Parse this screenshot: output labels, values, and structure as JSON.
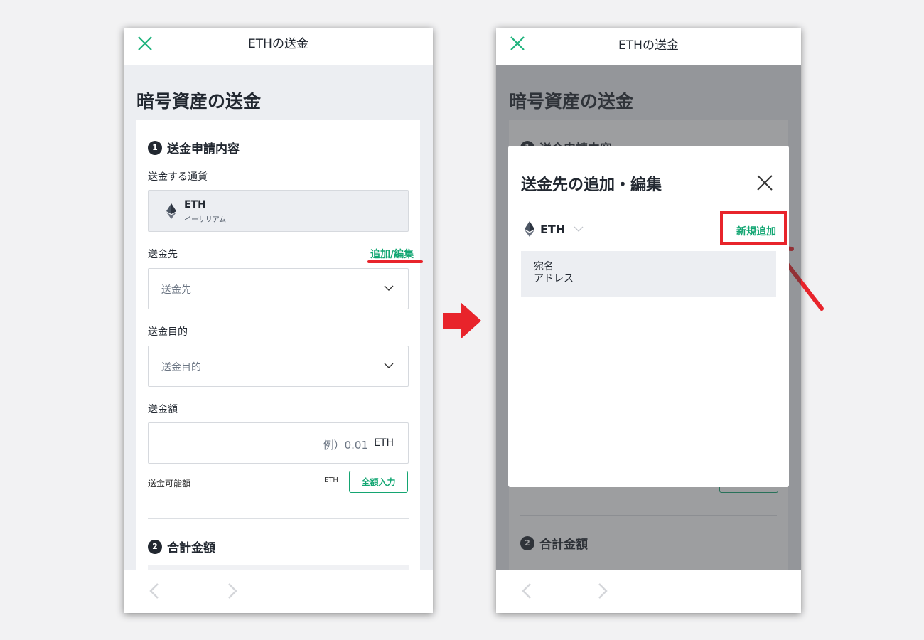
{
  "left": {
    "title": "ETHの送金",
    "page_heading": "暗号資産の送金",
    "step1": {
      "num": "1",
      "label": "送金申請内容"
    },
    "currency_label": "送金する通貨",
    "currency_symbol": "ETH",
    "currency_name": "イーサリアム",
    "destination_label": "送金先",
    "destination_link": "追加/編集",
    "destination_placeholder": "送金先",
    "purpose_label": "送金目的",
    "purpose_placeholder": "送金目的",
    "amount_label": "送金額",
    "amount_placeholder": "例）0.01",
    "amount_unit": "ETH",
    "available_label": "送金可能額",
    "available_unit": "ETH",
    "full_amount_button": "全額入力",
    "step2": {
      "num": "2",
      "label": "合計金額"
    }
  },
  "right": {
    "title": "ETHの送金",
    "page_heading": "暗号資産の送金",
    "bg_step1_label": "送金申請内容",
    "step2": {
      "num": "2",
      "label": "合計金額"
    },
    "modal": {
      "title": "送金先の追加・編集",
      "coin": "ETH",
      "new_add": "新規追加",
      "col_name": "宛名",
      "col_address": "アドレス"
    }
  },
  "colors": {
    "accent_green": "#12a672",
    "highlight_red": "#e8242b",
    "dark": "#222831"
  },
  "icons": [
    "close-icon",
    "ethereum-icon",
    "chevron-down-icon",
    "chevron-left-icon",
    "chevron-right-icon",
    "arrow-right-icon",
    "pointer-arrow-icon"
  ]
}
